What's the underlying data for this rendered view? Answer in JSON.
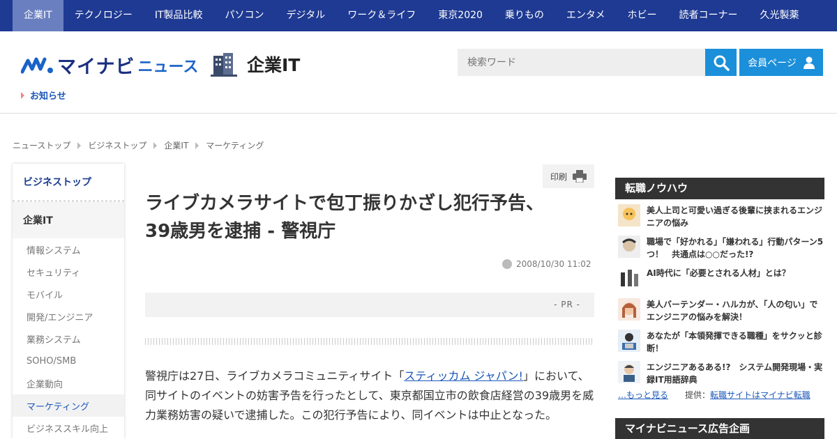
{
  "topnav": [
    "企業IT",
    "テクノロジー",
    "IT製品比較",
    "パソコン",
    "デジタル",
    "ワーク＆ライフ",
    "東京2020",
    "乗りもの",
    "エンタメ",
    "ホビー",
    "読者コーナー",
    "久光製薬"
  ],
  "header": {
    "logo": "マイナビ",
    "logo_sub": "ニュース",
    "section_title": "企業IT",
    "search_placeholder": "検索ワード",
    "member_label": "会員ページ",
    "notice": "お知らせ"
  },
  "breadcrumb": [
    "ニューストップ",
    "ビジネストップ",
    "企業IT",
    "マーケティング"
  ],
  "left_sidebar": {
    "top": "ビジネストップ",
    "current": "企業IT",
    "items": [
      "情報システム",
      "セキュリティ",
      "モバイル",
      "開発/エンジニア",
      "業務システム",
      "SOHO/SMB",
      "企業動向",
      "マーケティング",
      "ビジネススキル向上"
    ],
    "selected": "マーケティング"
  },
  "article": {
    "print_label": "印刷",
    "title": "ライブカメラサイトで包丁振りかざし犯行予告、39歳男を逮捕 - 警視庁",
    "date": "2008/10/30 11:02",
    "pr": "- PR -",
    "body_before": "警視庁は27日、ライブカメラコミュニティサイト「",
    "body_link": "スティッカム ジャパン!",
    "body_after": "」において、同サイトのイベントの妨害予告を行ったとして、東京都国立市の飲食店経営の39歳男を威力業務妨害の疑いで逮捕した。この犯行予告により、同イベントは中止となった。"
  },
  "right_sidebar": {
    "box1_title": "転職ノウハウ",
    "items": [
      "美人上司と可愛い過ぎる後輩に挟まれるエンジニアの悩み",
      "職場で「好かれる」「嫌われる」行動パターン5つ！　共通点は○○だった!?",
      "AI時代に「必要とされる人材」とは？",
      "美人バーテンダー・ハルカが、「人の匂い」でエンジニアの悩みを解決！",
      "あなたが「本領発揮できる職種」をサクッと診断！",
      "エンジニアあるある!?　システム開発現場・実録IT用語辞典"
    ],
    "more": "…もっと見る",
    "provider_label": "提供：",
    "provider_link": "転職サイトはマイナビ転職",
    "box2_title": "マイナビニュース広告企画"
  }
}
